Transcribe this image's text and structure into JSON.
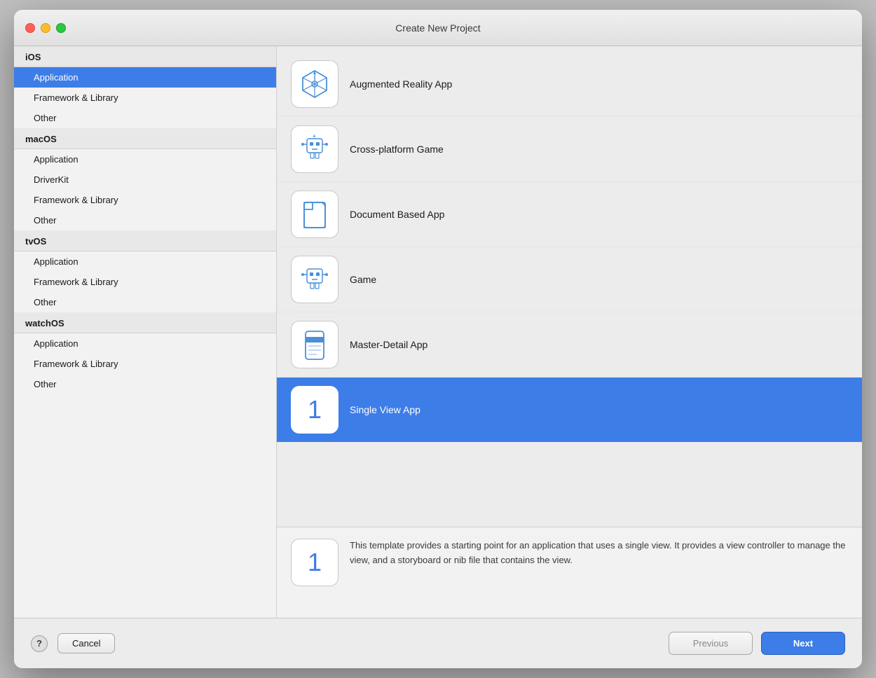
{
  "window": {
    "title": "Create New Project"
  },
  "sidebar": {
    "sections": [
      {
        "id": "ios",
        "label": "iOS",
        "items": [
          {
            "id": "ios-application",
            "label": "Application",
            "selected": true
          },
          {
            "id": "ios-framework",
            "label": "Framework & Library"
          },
          {
            "id": "ios-other",
            "label": "Other"
          }
        ]
      },
      {
        "id": "macos",
        "label": "macOS",
        "items": [
          {
            "id": "macos-application",
            "label": "Application"
          },
          {
            "id": "macos-driverkit",
            "label": "DriverKit"
          },
          {
            "id": "macos-framework",
            "label": "Framework & Library"
          },
          {
            "id": "macos-other",
            "label": "Other"
          }
        ]
      },
      {
        "id": "tvos",
        "label": "tvOS",
        "items": [
          {
            "id": "tvos-application",
            "label": "Application"
          },
          {
            "id": "tvos-framework",
            "label": "Framework & Library"
          },
          {
            "id": "tvos-other",
            "label": "Other"
          }
        ]
      },
      {
        "id": "watchos",
        "label": "watchOS",
        "items": [
          {
            "id": "watchos-application",
            "label": "Application"
          },
          {
            "id": "watchos-framework",
            "label": "Framework & Library"
          },
          {
            "id": "watchos-other",
            "label": "Other"
          }
        ]
      }
    ]
  },
  "templates": [
    {
      "id": "ar-app",
      "name": "Augmented Reality App",
      "icon": "ar",
      "selected": false
    },
    {
      "id": "crossplatform-game",
      "name": "Cross-platform Game",
      "icon": "game-robot",
      "selected": false
    },
    {
      "id": "document-based",
      "name": "Document Based App",
      "icon": "folder",
      "selected": false
    },
    {
      "id": "game",
      "name": "Game",
      "icon": "game-robot2",
      "selected": false
    },
    {
      "id": "master-detail",
      "name": "Master-Detail App",
      "icon": "master-detail",
      "selected": false
    },
    {
      "id": "single-view",
      "name": "Single View App",
      "icon": "number-one",
      "selected": true
    }
  ],
  "description": {
    "text": "This template provides a starting point for an application that uses a single view. It provides a view controller to manage the view, and a storyboard or nib file that contains the view."
  },
  "buttons": {
    "help": "?",
    "cancel": "Cancel",
    "previous": "Previous",
    "next": "Next"
  }
}
